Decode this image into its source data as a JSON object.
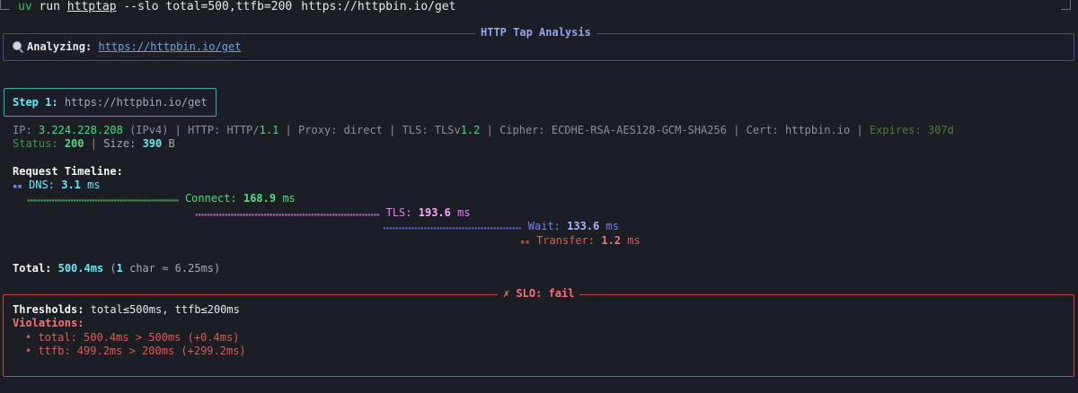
{
  "command": {
    "prefix": "uv",
    "run": "run",
    "package": "httptap",
    "args": "--slo total=500,ttfb=200",
    "url": "https://httpbin.io/get"
  },
  "analysis_panel": {
    "title": "HTTP Tap Analysis",
    "analyzing_label": "Analyzing:",
    "url": "https://httpbin.io/get"
  },
  "step": {
    "label": "Step 1:",
    "url": "https://httpbin.io/get"
  },
  "info": {
    "ip_label": "IP:",
    "ip": "3.224.228.208",
    "ip_version": "(IPv4)",
    "http_label": "HTTP:",
    "http_name": "HTTP/",
    "http_version": "1.1",
    "proxy": "Proxy: direct",
    "tls_label": "TLS:",
    "tls_name": "TLSv",
    "tls_version": "1.2",
    "cipher": "Cipher: ECDHE-RSA-AES128-GCM-SHA256",
    "cert": "Cert: httpbin.io",
    "expires": "Expires: 307d",
    "separator": "|",
    "status_label": "Status:",
    "status_code": "200",
    "size_label": "Size:",
    "size_value": "390",
    "size_unit": "B"
  },
  "timeline": {
    "heading": "Request Timeline:",
    "dns": {
      "bar": "▪▪",
      "label": "DNS:",
      "value": "3.1",
      "unit": "ms"
    },
    "connect": {
      "bar": "▪▪▪▪▪▪▪▪▪▪▪▪▪▪▪▪▪▪▪▪▪▪▪▪▪▪▪▪▪▪▪▪▪▪▪▪▪▪▪▪▪▪▪▪▪▪▪▪▪▪▪▪▪▪▪▪",
      "label": "Connect:",
      "value": "168.9",
      "unit": "ms"
    },
    "tls": {
      "bar": "▪▪▪▪▪▪▪▪▪▪▪▪▪▪▪▪▪▪▪▪▪▪▪▪▪▪▪▪▪▪▪▪▪▪▪▪▪▪▪▪▪▪▪▪▪▪▪▪▪▪▪▪▪▪▪▪▪▪▪▪▪▪",
      "label": "TLS:",
      "value": "193.6",
      "unit": "ms"
    },
    "wait": {
      "bar": "▪▪▪▪▪▪▪▪▪▪▪▪▪▪▪▪▪▪▪▪▪▪▪▪▪▪▪▪▪▪▪▪▪▪▪▪▪▪▪▪▪▪▪▪",
      "label": "Wait:",
      "value": "133.6",
      "unit": "ms"
    },
    "transfer": {
      "bar": "▪▪",
      "label": "Transfer:",
      "value": "1.2",
      "unit": "ms"
    },
    "total_label": "Total:",
    "total_value": "500.4ms",
    "scale_open": "(",
    "scale_one": "1",
    "scale_rest": " char ≈ 6.25ms)"
  },
  "slo": {
    "title": "✗ SLO: fail",
    "thresholds_label": "Thresholds:",
    "thresholds_value": "total≤500ms, ttfb≤200ms",
    "violations_label": "Violations:",
    "violations": [
      "• total: 500.4ms > 500ms (+0.4ms)",
      "• ttfb: 499.2ms > 200ms (+299.2ms)"
    ]
  }
}
